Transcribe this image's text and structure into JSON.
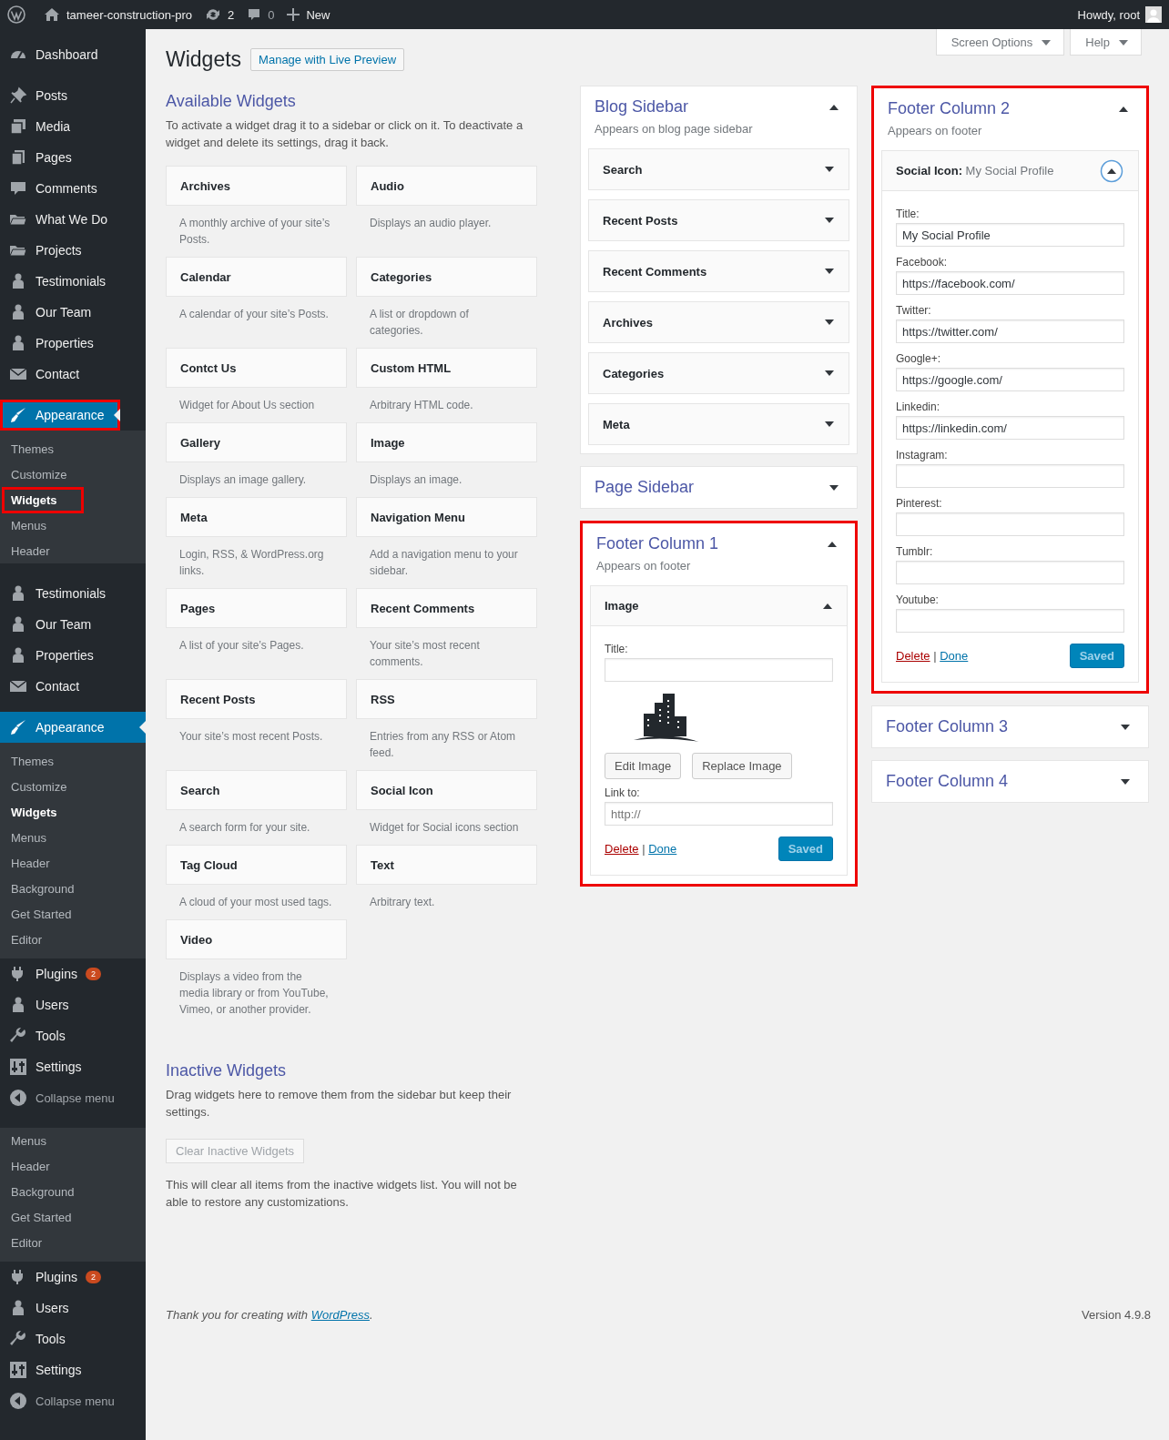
{
  "admin_bar": {
    "site_name": "tameer-construction-pro",
    "updates": "2",
    "comments": "0",
    "new_label": "New",
    "greeting": "Howdy, root"
  },
  "sidebar": [
    {
      "items": [
        {
          "kind": "menu",
          "label": "Dashboard",
          "selected": false,
          "highlighted": false
        },
        {
          "kind": "separator"
        },
        {
          "kind": "menu",
          "label": "Posts",
          "selected": false,
          "highlighted": false
        },
        {
          "kind": "menu",
          "label": "Media",
          "selected": false,
          "highlighted": false
        },
        {
          "kind": "menu",
          "label": "Pages",
          "selected": false,
          "highlighted": false
        },
        {
          "kind": "menu",
          "label": "Comments",
          "selected": false,
          "highlighted": false
        },
        {
          "kind": "menu",
          "label": "What We Do",
          "selected": false,
          "highlighted": false
        },
        {
          "kind": "menu",
          "label": "Projects",
          "selected": false,
          "highlighted": false
        },
        {
          "kind": "menu",
          "label": "Testimonials",
          "selected": false,
          "highlighted": false
        },
        {
          "kind": "menu",
          "label": "Our Team",
          "selected": false,
          "highlighted": false
        },
        {
          "kind": "menu",
          "label": "Properties",
          "selected": false,
          "highlighted": false
        },
        {
          "kind": "menu",
          "label": "Contact",
          "selected": false,
          "highlighted": false
        },
        {
          "kind": "separator"
        },
        {
          "kind": "menu",
          "label": "Appearance",
          "selected": true,
          "highlighted": true
        },
        {
          "kind": "sub",
          "label": "Themes",
          "selected": false,
          "highlighted": false
        },
        {
          "kind": "sub",
          "label": "Customize",
          "selected": false,
          "highlighted": false
        },
        {
          "kind": "sub",
          "label": "Widgets",
          "selected": true,
          "highlighted": true
        },
        {
          "kind": "sub",
          "label": "Menus",
          "selected": false,
          "highlighted": false
        },
        {
          "kind": "sub",
          "label": "Header",
          "selected": false,
          "highlighted": false
        }
      ]
    },
    {
      "items": [
        {
          "kind": "menu",
          "label": "Testimonials",
          "selected": false,
          "highlighted": false
        },
        {
          "kind": "menu",
          "label": "Our Team",
          "selected": false,
          "highlighted": false
        },
        {
          "kind": "menu",
          "label": "Properties",
          "selected": false,
          "highlighted": false
        },
        {
          "kind": "menu",
          "label": "Contact",
          "selected": false,
          "highlighted": false
        },
        {
          "kind": "separator"
        },
        {
          "kind": "menu",
          "label": "Appearance",
          "selected": true,
          "highlighted": false
        },
        {
          "kind": "sub",
          "label": "Themes",
          "selected": false,
          "highlighted": false
        },
        {
          "kind": "sub",
          "label": "Customize",
          "selected": false,
          "highlighted": false
        },
        {
          "kind": "sub",
          "label": "Widgets",
          "selected": true,
          "highlighted": false
        },
        {
          "kind": "sub",
          "label": "Menus",
          "selected": false,
          "highlighted": false
        },
        {
          "kind": "sub",
          "label": "Header",
          "selected": false,
          "highlighted": false
        },
        {
          "kind": "sub",
          "label": "Background",
          "selected": false,
          "highlighted": false
        },
        {
          "kind": "sub",
          "label": "Get Started",
          "selected": false,
          "highlighted": false
        },
        {
          "kind": "sub",
          "label": "Editor",
          "selected": false,
          "highlighted": false
        },
        {
          "kind": "menu",
          "label": "Plugins",
          "badge": "2",
          "selected": false,
          "highlighted": false
        },
        {
          "kind": "menu",
          "label": "Users",
          "selected": false,
          "highlighted": false
        },
        {
          "kind": "menu",
          "label": "Tools",
          "selected": false,
          "highlighted": false
        },
        {
          "kind": "menu",
          "label": "Settings",
          "selected": false,
          "highlighted": false
        },
        {
          "kind": "collapse",
          "label": "Collapse menu",
          "selected": false,
          "highlighted": false
        }
      ]
    },
    {
      "items": [
        {
          "kind": "sub",
          "label": "Menus",
          "selected": false,
          "highlighted": false
        },
        {
          "kind": "sub",
          "label": "Header",
          "selected": false,
          "highlighted": false
        },
        {
          "kind": "sub",
          "label": "Background",
          "selected": false,
          "highlighted": false
        },
        {
          "kind": "sub",
          "label": "Get Started",
          "selected": false,
          "highlighted": false
        },
        {
          "kind": "sub",
          "label": "Editor",
          "selected": false,
          "highlighted": false
        },
        {
          "kind": "menu",
          "label": "Plugins",
          "badge": "2",
          "selected": false,
          "highlighted": false
        },
        {
          "kind": "menu",
          "label": "Users",
          "selected": false,
          "highlighted": false
        },
        {
          "kind": "menu",
          "label": "Tools",
          "selected": false,
          "highlighted": false
        },
        {
          "kind": "menu",
          "label": "Settings",
          "selected": false,
          "highlighted": false
        },
        {
          "kind": "collapse",
          "label": "Collapse menu",
          "selected": false,
          "highlighted": false
        }
      ]
    }
  ],
  "screen_options": "Screen Options",
  "help": "Help",
  "page_title": "Widgets",
  "live_preview": "Manage with Live Preview",
  "available": {
    "title": "Available Widgets",
    "description": "To activate a widget drag it to a sidebar or click on it. To deactivate a widget and delete its settings, drag it back.",
    "widgets": [
      {
        "name": "Archives",
        "description": "A monthly archive of your site’s Posts."
      },
      {
        "name": "Audio",
        "description": "Displays an audio player."
      },
      {
        "name": "Calendar",
        "description": "A calendar of your site’s Posts."
      },
      {
        "name": "Categories",
        "description": "A list or dropdown of categories."
      },
      {
        "name": "Contct Us",
        "description": "Widget for About Us section"
      },
      {
        "name": "Custom HTML",
        "description": "Arbitrary HTML code."
      },
      {
        "name": "Gallery",
        "description": "Displays an image gallery."
      },
      {
        "name": "Image",
        "description": "Displays an image."
      },
      {
        "name": "Meta",
        "description": "Login, RSS, & WordPress.org links."
      },
      {
        "name": "Navigation Menu",
        "description": "Add a navigation menu to your sidebar."
      },
      {
        "name": "Pages",
        "description": "A list of your site’s Pages."
      },
      {
        "name": "Recent Comments",
        "description": "Your site’s most recent comments."
      },
      {
        "name": "Recent Posts",
        "description": "Your site’s most recent Posts."
      },
      {
        "name": "RSS",
        "description": "Entries from any RSS or Atom feed."
      },
      {
        "name": "Search",
        "description": "A search form for your site."
      },
      {
        "name": "Social Icon",
        "description": "Widget for Social icons section"
      },
      {
        "name": "Tag Cloud",
        "description": "A cloud of your most used tags."
      },
      {
        "name": "Text",
        "description": "Arbitrary text."
      },
      {
        "name": "Video",
        "description": "Displays a video from the media library or from YouTube, Vimeo, or another provider."
      }
    ]
  },
  "inactive": {
    "title": "Inactive Widgets",
    "description": "Drag widgets here to remove them from the sidebar but keep their settings.",
    "clear_button": "Clear Inactive Widgets",
    "clear_disabled": true,
    "note": "This will clear all items from the inactive widgets list. You will not be able to restore any customizations."
  },
  "columns": [
    [
      {
        "title": "Blog Sidebar",
        "description": "Appears on blog page sidebar",
        "expanded": true,
        "highlighted": false,
        "widgets": [
          {
            "name": "Search",
            "expanded": false
          },
          {
            "name": "Recent Posts",
            "expanded": false
          },
          {
            "name": "Recent Comments",
            "expanded": false
          },
          {
            "name": "Archives",
            "expanded": false
          },
          {
            "name": "Categories",
            "expanded": false
          },
          {
            "name": "Meta",
            "expanded": false
          }
        ]
      },
      {
        "title": "Page Sidebar",
        "expanded": false,
        "highlighted": false
      },
      {
        "title": "Footer Column 1",
        "description": "Appears on footer",
        "expanded": true,
        "highlighted": true,
        "widgets": [
          {
            "name": "Image",
            "expanded": true,
            "focused": false,
            "form": [
              {
                "kind": "field",
                "label": "Title:"
              },
              {
                "kind": "image"
              },
              {
                "kind": "buttons",
                "labels": [
                  "Edit Image",
                  "Replace Image"
                ]
              },
              {
                "kind": "field",
                "label": "Link to:",
                "placeholder": "http://"
              }
            ],
            "delete": "Delete",
            "link_separator": "|",
            "done": "Done",
            "save": "Saved"
          }
        ]
      }
    ],
    [
      {
        "title": "Footer Column 2",
        "description": "Appears on footer",
        "expanded": true,
        "highlighted": true,
        "widgets": [
          {
            "name": "Social Icon:",
            "subtitle": "My Social Profile",
            "expanded": true,
            "focused": true,
            "form": [
              {
                "kind": "field",
                "label": "Title:",
                "value": "My Social Profile"
              },
              {
                "kind": "field",
                "label": "Facebook:",
                "value": "https://facebook.com/"
              },
              {
                "kind": "field",
                "label": "Twitter:",
                "value": "https://twitter.com/"
              },
              {
                "kind": "field",
                "label": "Google+:",
                "value": "https://google.com/"
              },
              {
                "kind": "field",
                "label": "Linkedin:",
                "value": "https://linkedin.com/"
              },
              {
                "kind": "field",
                "label": "Instagram:"
              },
              {
                "kind": "field",
                "label": "Pinterest:"
              },
              {
                "kind": "field",
                "label": "Tumblr:"
              },
              {
                "kind": "field",
                "label": "Youtube:"
              }
            ],
            "delete": "Delete",
            "link_separator": "|",
            "done": "Done",
            "save": "Saved"
          }
        ]
      },
      {
        "title": "Footer Column 3",
        "expanded": false,
        "highlighted": false
      },
      {
        "title": "Footer Column 4",
        "expanded": false,
        "highlighted": false
      }
    ]
  ],
  "footer": {
    "credit": "Thank you for creating with",
    "credit_link": "WordPress",
    "credit_end": ".",
    "version": "Version 4.9.8"
  }
}
